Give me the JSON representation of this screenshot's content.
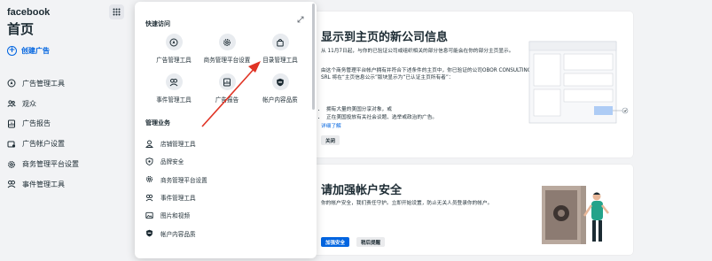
{
  "sidebar": {
    "brand": "facebook",
    "title": "首页",
    "create_ad": "创建广告",
    "items": [
      {
        "label": "广告管理工具",
        "icon": "ads-manager-icon"
      },
      {
        "label": "观众",
        "icon": "audience-icon"
      },
      {
        "label": "广告报告",
        "icon": "ads-report-icon"
      },
      {
        "label": "广告帐户设置",
        "icon": "ad-account-settings-icon"
      },
      {
        "label": "商务管理平台设置",
        "icon": "gear-icon"
      },
      {
        "label": "事件管理工具",
        "icon": "events-manager-icon"
      }
    ]
  },
  "popup": {
    "quick_access_title": "快速访问",
    "quick_access": [
      {
        "label": "广告管理工具",
        "icon": "ads-manager-icon"
      },
      {
        "label": "商务管理平台设置",
        "icon": "gear-icon"
      },
      {
        "label": "目录管理工具",
        "icon": "bag-icon"
      },
      {
        "label": "事件管理工具",
        "icon": "events-manager-icon"
      },
      {
        "label": "广告报告",
        "icon": "ads-report-icon"
      },
      {
        "label": "帐户内容品质",
        "icon": "shield-icon"
      }
    ],
    "business_title": "管理业务",
    "business_items": [
      {
        "label": "店铺管理工具",
        "icon": "store-icon"
      },
      {
        "label": "品牌安全",
        "icon": "brand-safety-icon"
      },
      {
        "label": "商务管理平台设置",
        "icon": "gear-icon"
      },
      {
        "label": "事件管理工具",
        "icon": "events-manager-icon"
      },
      {
        "label": "图片和视频",
        "icon": "media-icon"
      },
      {
        "label": "帐户内容品质",
        "icon": "shield-icon"
      }
    ]
  },
  "card1": {
    "title": "显示到主页的新公司信息",
    "p1": "从 11月7日起，与你的已验证公司或组织相关的部分信息可能会在你的部分主页显示。",
    "p2": "由这个商务管理平台帐户拥有并符合下述条件的主页中，你已验证的公司OBOR CONSULTING SRL 将在“主页信息公示”版块显示为“已认证主页所有者”：",
    "bullets": [
      "拥有大量的美国分享对象，或",
      "正在美国投放有关社会议题、选举或政治的广告。"
    ],
    "link": "详细了解",
    "close_button": "关闭"
  },
  "card2": {
    "title": "请加强帐户安全",
    "p1": "你的帐户安全，我们责任守护。立即开始设置，防止无关人员登录你的帐户。",
    "primary_button": "加强安全",
    "secondary_button": "稍后提醒"
  },
  "colors": {
    "accent": "#0064e0",
    "arrow": "#e03324"
  }
}
